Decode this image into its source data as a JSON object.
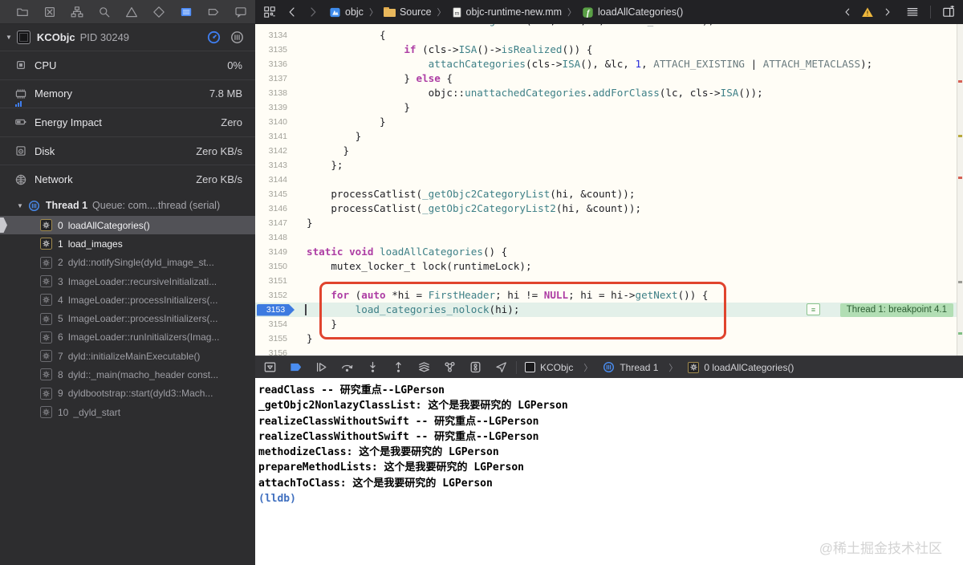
{
  "topbar": {
    "navigator_icons": [
      "project",
      "source-control",
      "symbol",
      "find",
      "issue",
      "test",
      "debug",
      "breakpoint",
      "report"
    ],
    "jumpbar": {
      "project": "objc",
      "folder": "Source",
      "file": "objc-runtime-new.mm",
      "symbol": "loadAllCategories()",
      "separator": "〉"
    }
  },
  "sidebar": {
    "process": {
      "name": "KCObjc",
      "pid": "PID 30249"
    },
    "gauges": [
      {
        "icon": "cpu",
        "label": "CPU",
        "value": "0%"
      },
      {
        "icon": "memory",
        "label": "Memory",
        "value": "7.8 MB"
      },
      {
        "icon": "energy",
        "label": "Energy Impact",
        "value": "Zero"
      },
      {
        "icon": "disk",
        "label": "Disk",
        "value": "Zero KB/s"
      },
      {
        "icon": "network",
        "label": "Network",
        "value": "Zero KB/s"
      }
    ],
    "thread": {
      "name": "Thread 1",
      "queue": "Queue: com....thread (serial)"
    },
    "frames": [
      {
        "index": "0",
        "label": "loadAllCategories()",
        "bright": true,
        "selected": true,
        "current": true
      },
      {
        "index": "1",
        "label": "load_images",
        "bright": true
      },
      {
        "index": "2",
        "label": "dyld::notifySingle(dyld_image_st..."
      },
      {
        "index": "3",
        "label": "ImageLoader::recursiveInitializati..."
      },
      {
        "index": "4",
        "label": "ImageLoader::processInitializers(..."
      },
      {
        "index": "5",
        "label": "ImageLoader::processInitializers(..."
      },
      {
        "index": "6",
        "label": "ImageLoader::runInitializers(Imag..."
      },
      {
        "index": "7",
        "label": "dyld::initializeMainExecutable()"
      },
      {
        "index": "8",
        "label": "dyld::_main(macho_header const..."
      },
      {
        "index": "9",
        "label": "dyldbootstrap::start(dyld3::Mach..."
      },
      {
        "index": "10",
        "label": "_dyld_start"
      }
    ]
  },
  "editor": {
    "breakpoint_line": "3153",
    "breakpoint_hit_label": "Thread 1: breakpoint 4.1",
    "breakpoint_eq_glyph": "≡",
    "lines": [
      {
        "num": "",
        "partial": true,
        "tokens": [
          [
            "p",
            "                    "
          ],
          [
            "f",
            "attachCategories"
          ],
          [
            "p",
            "(cls, &lc, "
          ],
          [
            "n",
            "1"
          ],
          [
            "p",
            ", "
          ],
          [
            "m",
            "ATTACH_EXISTING"
          ],
          [
            "p",
            ");"
          ]
        ]
      },
      {
        "num": "3134",
        "tokens": [
          [
            "p",
            "            {"
          ]
        ]
      },
      {
        "num": "3135",
        "tokens": [
          [
            "p",
            "                "
          ],
          [
            "k",
            "if"
          ],
          [
            "p",
            " (cls->"
          ],
          [
            "f",
            "ISA"
          ],
          [
            "p",
            "()->"
          ],
          [
            "f",
            "isRealized"
          ],
          [
            "p",
            "()) {"
          ]
        ]
      },
      {
        "num": "3136",
        "tokens": [
          [
            "p",
            "                    "
          ],
          [
            "f",
            "attachCategories"
          ],
          [
            "p",
            "(cls->"
          ],
          [
            "f",
            "ISA"
          ],
          [
            "p",
            "(), &lc, "
          ],
          [
            "n",
            "1"
          ],
          [
            "p",
            ", "
          ],
          [
            "m",
            "ATTACH_EXISTING"
          ],
          [
            "p",
            " | "
          ],
          [
            "m",
            "ATTACH_METACLASS"
          ],
          [
            "p",
            ");"
          ]
        ]
      },
      {
        "num": "3137",
        "tokens": [
          [
            "p",
            "                } "
          ],
          [
            "k",
            "else"
          ],
          [
            "p",
            " {"
          ]
        ]
      },
      {
        "num": "3138",
        "tokens": [
          [
            "p",
            "                    objc::"
          ],
          [
            "f",
            "unattachedCategories"
          ],
          [
            "p",
            "."
          ],
          [
            "f",
            "addForClass"
          ],
          [
            "p",
            "(lc, cls->"
          ],
          [
            "f",
            "ISA"
          ],
          [
            "p",
            "());"
          ]
        ]
      },
      {
        "num": "3139",
        "tokens": [
          [
            "p",
            "                }"
          ]
        ]
      },
      {
        "num": "3140",
        "tokens": [
          [
            "p",
            "            }"
          ]
        ]
      },
      {
        "num": "3141",
        "tokens": [
          [
            "p",
            "        }"
          ]
        ]
      },
      {
        "num": "3142",
        "tokens": [
          [
            "p",
            "      }"
          ]
        ]
      },
      {
        "num": "3143",
        "tokens": [
          [
            "p",
            "    };"
          ]
        ]
      },
      {
        "num": "3144",
        "tokens": []
      },
      {
        "num": "3145",
        "tokens": [
          [
            "p",
            "    processCatlist("
          ],
          [
            "f",
            "_getObjc2CategoryList"
          ],
          [
            "p",
            "(hi, &count));"
          ]
        ]
      },
      {
        "num": "3146",
        "tokens": [
          [
            "p",
            "    processCatlist("
          ],
          [
            "f",
            "_getObjc2CategoryList2"
          ],
          [
            "p",
            "(hi, &count));"
          ]
        ]
      },
      {
        "num": "3147",
        "tokens": [
          [
            "p",
            "}"
          ]
        ]
      },
      {
        "num": "3148",
        "tokens": []
      },
      {
        "num": "3149",
        "tokens": [
          [
            "k",
            "static"
          ],
          [
            "p",
            " "
          ],
          [
            "k",
            "void"
          ],
          [
            "p",
            " "
          ],
          [
            "f",
            "loadAllCategories"
          ],
          [
            "p",
            "() {"
          ]
        ]
      },
      {
        "num": "3150",
        "tokens": [
          [
            "p",
            "    mutex_locker_t lock(runtimeLock);"
          ]
        ]
      },
      {
        "num": "3151",
        "tokens": []
      },
      {
        "num": "3152",
        "tokens": [
          [
            "p",
            "    "
          ],
          [
            "k",
            "for"
          ],
          [
            "p",
            " ("
          ],
          [
            "k",
            "auto"
          ],
          [
            "p",
            " *hi = "
          ],
          [
            "f",
            "FirstHeader"
          ],
          [
            "p",
            "; hi != "
          ],
          [
            "k",
            "NULL"
          ],
          [
            "p",
            "; hi = hi->"
          ],
          [
            "f",
            "getNext"
          ],
          [
            "p",
            "()) {"
          ]
        ]
      },
      {
        "num": "3153",
        "bp": true,
        "tokens": [
          [
            "p",
            "        "
          ],
          [
            "f",
            "load_categories_nolock"
          ],
          [
            "p",
            "(hi);"
          ]
        ]
      },
      {
        "num": "3154",
        "tokens": [
          [
            "p",
            "    }"
          ]
        ]
      },
      {
        "num": "3155",
        "tokens": [
          [
            "p",
            "}"
          ]
        ]
      },
      {
        "num": "3156",
        "tokens": []
      }
    ]
  },
  "debugbar": {
    "icons": [
      "hide-debug-area",
      "breakpoints-enabled",
      "continue",
      "step-over",
      "step-into",
      "step-out",
      "view-hierarchy",
      "memory-graph",
      "environment-overrides",
      "simulate-location"
    ],
    "breadcrumb": {
      "app": "KCObjc",
      "thread": "Thread 1",
      "frame": "0 loadAllCategories()",
      "separator": "〉"
    }
  },
  "console": {
    "lines": [
      "readClass -- 研究重点--LGPerson",
      "_getObjc2NonlazyClassList: 这个是我要研究的 LGPerson",
      "realizeClassWithoutSwift -- 研究重点--LGPerson",
      "realizeClassWithoutSwift -- 研究重点--LGPerson",
      "methodizeClass: 这个是我要研究的 LGPerson",
      "prepareMethodLists: 这个是我要研究的 LGPerson",
      "attachToClass: 这个是我要研究的 LGPerson",
      "(lldb) "
    ],
    "prompt": "(lldb)"
  },
  "watermark": "@稀土掘金技术社区",
  "colors": {
    "breakpoint_badge": "#3d7ae0",
    "annotation_red": "#e0442e",
    "breakpoint_hit_green": "#b2deb4",
    "keyword": "#ad3da4",
    "function": "#3e8087",
    "number": "#272ad8",
    "macro": "#697a7e",
    "lldb_prompt": "#3f6fbf",
    "debug_accent_blue": "#4a8df0"
  }
}
